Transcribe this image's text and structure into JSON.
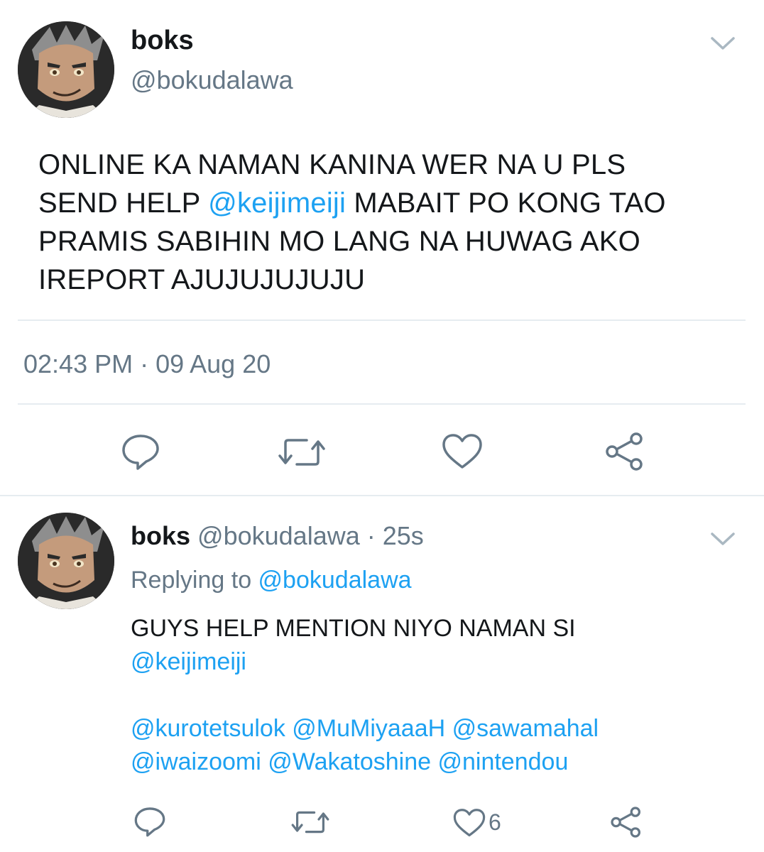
{
  "colors": {
    "text": "#14171a",
    "muted": "#657786",
    "link": "#1da1f2",
    "divider": "#e6ecf0"
  },
  "main_tweet": {
    "name": "boks",
    "handle": "@bokudalawa",
    "text_lines": [
      {
        "parts": [
          "ONLINE KA NAMAN KANINA WER NA U PLS"
        ]
      },
      {
        "parts": [
          "SEND HELP ",
          "@keijimeiji",
          " MABAIT PO KONG TAO"
        ]
      },
      {
        "parts": [
          "PRAMIS SABIHIN MO LANG NA HUWAG AKO"
        ]
      },
      {
        "parts": [
          "IREPORT AJUJUJUJUJU"
        ]
      }
    ],
    "line1": "ONLINE KA NAMAN KANINA WER NA U PLS",
    "line2_pre": "SEND HELP ",
    "line2_mention": "@keijimeiji",
    "line2_post": " MABAIT PO KONG TAO",
    "line3": "PRAMIS SABIHIN MO LANG NA HUWAG AKO",
    "line4": "IREPORT AJUJUJUJUJU",
    "timestamp": "02:43 PM · 09 Aug 20",
    "actions": [
      "reply-icon",
      "retweet-icon",
      "like-icon",
      "share-icon"
    ]
  },
  "reply_tweet": {
    "name": "boks",
    "handle": "@bokudalawa",
    "time": "· 25s",
    "replying_prefix": "Replying to ",
    "replying_to": "@bokudalawa",
    "line1": "GUYS HELP MENTION NIYO NAMAN SI",
    "line2": "@keijimeiji",
    "mentions_line1": "@kurotetsulok @MuMiyaaaH @sawamahal",
    "mentions_line2": "@iwaizoomi @Wakatoshine @nintendou",
    "like_count": "6",
    "actions": [
      "reply-icon",
      "retweet-icon",
      "like-icon",
      "share-icon"
    ]
  }
}
